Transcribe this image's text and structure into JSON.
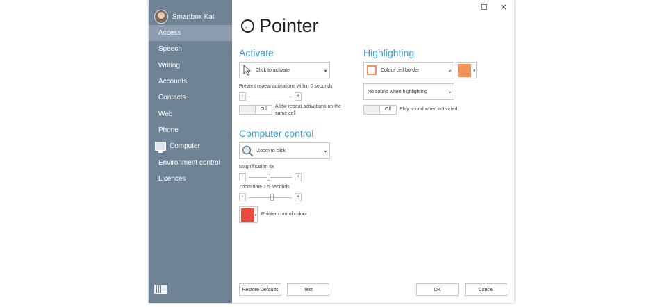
{
  "window": {
    "maximize_glyph": "☐",
    "close_glyph": "✕"
  },
  "user": {
    "name": "Smartbox Kat"
  },
  "sidebar": {
    "items": [
      {
        "label": "Access",
        "active": true
      },
      {
        "label": "Speech"
      },
      {
        "label": "Writing"
      },
      {
        "label": "Accounts"
      },
      {
        "label": "Contacts"
      },
      {
        "label": "Web"
      },
      {
        "label": "Phone"
      },
      {
        "label": "Computer",
        "icon": "monitor-icon"
      },
      {
        "label": "Environment control"
      },
      {
        "label": "Licences"
      }
    ]
  },
  "page": {
    "title": "Pointer",
    "back_glyph": "←"
  },
  "activate": {
    "title": "Activate",
    "mode": "Click to activate",
    "prevent_label": "Prevent repeat activations within 0 seconds",
    "allow_toggle_state": "Off",
    "allow_label": "Allow repeat activations on the same cell"
  },
  "highlighting": {
    "title": "Highlighting",
    "style": "Colour cell border",
    "colour": "#f39259",
    "sound": "No sound when highlighting",
    "play_toggle_state": "Off",
    "play_label": "Play sound when activated"
  },
  "computer_control": {
    "title": "Computer control",
    "mode": "Zoom to click",
    "magnification_label": "Magnification 6x",
    "magnification_level": 0.45,
    "zoom_time_label": "Zoom time 2.5 seconds",
    "zoom_time_level": 0.55,
    "pointer_colour": "#e84a3c",
    "pointer_colour_label": "Pointer control colour"
  },
  "stepper": {
    "minus": "-",
    "plus": "+"
  },
  "dropdown_arrow": "▾",
  "footer": {
    "restore": "Restore Defaults",
    "test": "Test",
    "ok": "OK",
    "cancel": "Cancel"
  },
  "colors": {
    "sidebar": "#6f8396",
    "sidebar_active": "#8d9daf",
    "accent": "#3b9fd6"
  },
  "icons": [
    "user-avatar",
    "back-arrow-icon",
    "cursor-arrow-icon",
    "magnifier-icon",
    "monitor-icon",
    "keyboard-icon"
  ]
}
